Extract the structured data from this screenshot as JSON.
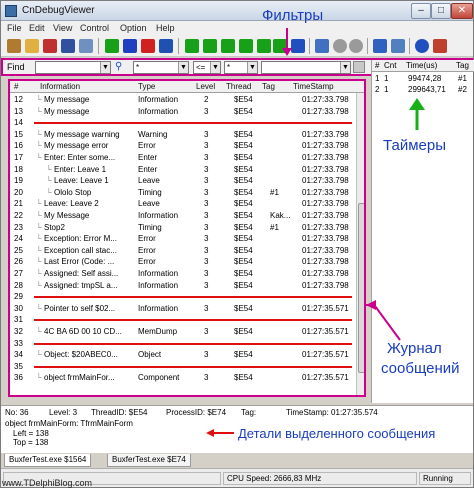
{
  "window": {
    "title": "CnDebugViewer"
  },
  "menu": [
    "File",
    "Edit",
    "View",
    "Control",
    "Option",
    "Help"
  ],
  "filterbar": {
    "find_label": "Find",
    "find_value": "",
    "type_value": "*",
    "level_op": "<=",
    "level_value": "*",
    "thread_value": ""
  },
  "grid": {
    "headers": {
      "no": "#",
      "info": "Information",
      "type": "Type",
      "level": "Level",
      "thread": "Thread",
      "tag": "Tag",
      "timestamp": "TimeStamp"
    },
    "rows": [
      {
        "no": "12",
        "indent": 1,
        "info": "My message",
        "type": "Information",
        "level": "2",
        "thread": "$E54",
        "tag": "",
        "ts": "01:27:33.798"
      },
      {
        "no": "13",
        "indent": 1,
        "info": "My message",
        "type": "Information",
        "level": "3",
        "thread": "$E54",
        "tag": "",
        "ts": "01:27:33.798"
      },
      {
        "no": "14",
        "separator": true
      },
      {
        "no": "15",
        "indent": 1,
        "info": "My message warning",
        "type": "Warning",
        "level": "3",
        "thread": "$E54",
        "tag": "",
        "ts": "01:27:33.798"
      },
      {
        "no": "16",
        "indent": 1,
        "info": "My message error",
        "type": "Error",
        "level": "3",
        "thread": "$E54",
        "tag": "",
        "ts": "01:27:33.798"
      },
      {
        "no": "17",
        "indent": 1,
        "info": "Enter: Enter some...",
        "type": "Enter",
        "level": "3",
        "thread": "$E54",
        "tag": "",
        "ts": "01:27:33.798"
      },
      {
        "no": "18",
        "indent": 2,
        "info": "Enter: Leave 1",
        "type": "Enter",
        "level": "3",
        "thread": "$E54",
        "tag": "",
        "ts": "01:27:33.798"
      },
      {
        "no": "19",
        "indent": 2,
        "info": "Leave: Leave 1",
        "type": "Leave",
        "level": "3",
        "thread": "$E54",
        "tag": "",
        "ts": "01:27:33.798"
      },
      {
        "no": "20",
        "indent": 2,
        "info": "Ololo Stop",
        "type": "Timing",
        "level": "3",
        "thread": "$E54",
        "tag": "#1",
        "ts": "01:27:33.798"
      },
      {
        "no": "21",
        "indent": 1,
        "info": "Leave: Leave 2",
        "type": "Leave",
        "level": "3",
        "thread": "$E54",
        "tag": "",
        "ts": "01:27:33.798"
      },
      {
        "no": "22",
        "indent": 1,
        "info": "My Message",
        "type": "Information",
        "level": "3",
        "thread": "$E54",
        "tag": "Kak...",
        "ts": "01:27:33.798"
      },
      {
        "no": "23",
        "indent": 1,
        "info": "Stop2",
        "type": "Timing",
        "level": "3",
        "thread": "$E54",
        "tag": "#1",
        "ts": "01:27:33.798"
      },
      {
        "no": "24",
        "indent": 1,
        "info": "Exception: Error M...",
        "type": "Error",
        "level": "3",
        "thread": "$E54",
        "tag": "",
        "ts": "01:27:33.798"
      },
      {
        "no": "25",
        "indent": 1,
        "info": "Exception call stac...",
        "type": "Error",
        "level": "3",
        "thread": "$E54",
        "tag": "",
        "ts": "01:27:33.798"
      },
      {
        "no": "26",
        "indent": 1,
        "info": "Last Error (Code: ...",
        "type": "Error",
        "level": "3",
        "thread": "$E54",
        "tag": "",
        "ts": "01:27:33.798"
      },
      {
        "no": "27",
        "indent": 1,
        "info": "Assigned: Self assi...",
        "type": "Information",
        "level": "3",
        "thread": "$E54",
        "tag": "",
        "ts": "01:27:33.798"
      },
      {
        "no": "28",
        "indent": 1,
        "info": "Assigned: tmpSL a...",
        "type": "Information",
        "level": "3",
        "thread": "$E54",
        "tag": "",
        "ts": "01:27:33.798"
      },
      {
        "no": "29",
        "separator": true
      },
      {
        "no": "30",
        "indent": 1,
        "info": "Pointer to self $02...",
        "type": "Information",
        "level": "3",
        "thread": "$E54",
        "tag": "",
        "ts": "01:27:35.571"
      },
      {
        "no": "31",
        "separator": true
      },
      {
        "no": "32",
        "indent": 1,
        "info": "4C BA 6D 00 10 CD...",
        "type": "MemDump",
        "level": "3",
        "thread": "$E54",
        "tag": "",
        "ts": "01:27:35.571"
      },
      {
        "no": "33",
        "separator": true
      },
      {
        "no": "34",
        "indent": 1,
        "info": "Object: $20ABEC0...",
        "type": "Object",
        "level": "3",
        "thread": "$E54",
        "tag": "",
        "ts": "01:27:35.571"
      },
      {
        "no": "35",
        "separator": true
      },
      {
        "no": "36",
        "indent": 1,
        "info": "object frmMainFor...",
        "type": "Component",
        "level": "3",
        "thread": "$E54",
        "tag": "",
        "ts": "01:27:35.571"
      }
    ]
  },
  "timers": {
    "headers": {
      "no": "#",
      "cnt": "Cnt",
      "time": "Time(us)",
      "tag": "Tag"
    },
    "rows": [
      {
        "no": "1",
        "cnt": "1",
        "time": "99474,28",
        "tag": "#1"
      },
      {
        "no": "2",
        "cnt": "1",
        "time": "299643,71",
        "tag": "#2"
      }
    ]
  },
  "details": {
    "no": "No: 36",
    "level": "Level: 3",
    "thread": "ThreadID: $E54",
    "process": "ProcessID: $E74",
    "tag": "Tag:",
    "timestamp": "TimeStamp: 01:27:35.574",
    "line1": "object frmMainForm: TfrmMainForm",
    "line2": "Left = 138",
    "line3": "Top = 138"
  },
  "tabs": [
    "BuxferTest.exe $1564",
    "BuxferTest.exe $E74"
  ],
  "status": {
    "cpu": "CPU Speed: 2666,83 MHz",
    "state": "Running"
  },
  "annotations": {
    "filters": "Фильтры",
    "timers": "Таймеры",
    "journal_line1": "Журнал",
    "journal_line2": "сообщений",
    "details": "Детали выделенного сообщения",
    "watermark": "www.TDelphiBlog.com"
  },
  "colors": {
    "highlight_border": "#c8008c",
    "separator_line": "#e01010",
    "annotation_text": "#1a3dbd",
    "arrow_green": "#18b018"
  }
}
